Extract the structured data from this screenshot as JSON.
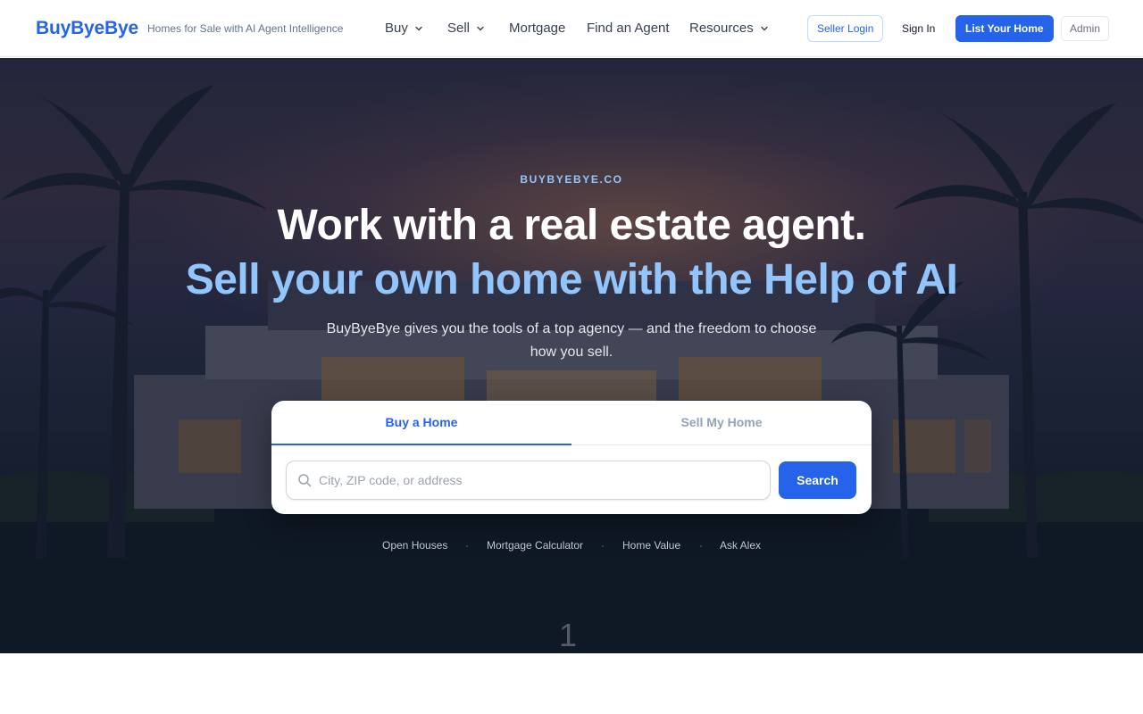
{
  "header": {
    "logo": "BuyByeBye",
    "tagline": "Homes for Sale with AI Agent Intelligence",
    "nav": [
      {
        "label": "Buy",
        "icon": "chevron-down-icon"
      },
      {
        "label": "Sell",
        "icon": "chevron-down-icon"
      },
      {
        "label": "Mortgage"
      },
      {
        "label": "Find an Agent"
      },
      {
        "label": "Resources",
        "icon": "chevron-down-icon"
      }
    ],
    "seller_login": "Seller Login",
    "sign_in": "Sign In",
    "list_home": "List Your Home",
    "admin": "Admin"
  },
  "hero": {
    "eyebrow": "BUYBYEBYE.CO",
    "headline": "Work with a real estate agent.",
    "headline_accent": "Sell your own home with the Help of AI",
    "subtitle": "BuyByeBye gives you the tools of a top agency — and the freedom to choose how you sell."
  },
  "search_card": {
    "tabs": [
      {
        "label": "Buy a Home",
        "active": true
      },
      {
        "label": "Sell My Home",
        "active": false
      }
    ],
    "search_placeholder": "City, ZIP code, or address",
    "search_value": "",
    "search_button": "Search"
  },
  "quick_links": [
    "Open Houses",
    "Mortgage Calculator",
    "Home Value",
    "Ask Alex"
  ],
  "quick_separator": "·",
  "page_indicator": "1",
  "colors": {
    "brand": "#2563eb",
    "accent_light": "#93c5fd",
    "hero_dark": "#151d2e"
  }
}
